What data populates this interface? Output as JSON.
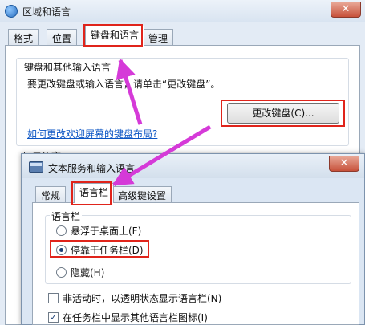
{
  "outer_window": {
    "title": "区域和语言",
    "close_glyph": "✕",
    "tabs": [
      "格式",
      "位置",
      "键盘和语言",
      "管理"
    ],
    "group_title": "键盘和其他输入语言",
    "group_desc": "要更改键盘或输入语言，请单击“更改键盘”。",
    "change_keyboard_button": "更改键盘(C)...",
    "keyboard_layout_link": "如何更改欢迎屏幕的键盘布局?",
    "display_language_label": "显示语言"
  },
  "inner_dialog": {
    "title": "文本服务和输入语言",
    "close_glyph": "✕",
    "tabs": [
      "常规",
      "语言栏",
      "高级键设置"
    ],
    "language_bar_group_title": "语言栏",
    "options": [
      {
        "label": "悬浮于桌面上(F)",
        "selected": false
      },
      {
        "label": "停靠于任务栏(D)",
        "selected": true
      },
      {
        "label": "隐藏(H)",
        "selected": false
      }
    ],
    "checkboxes": [
      {
        "label": "非活动时，以透明状态显示语言栏(N)",
        "checked": false
      },
      {
        "label": "在任务栏中显示其他语言栏图标(I)",
        "checked": true
      }
    ]
  },
  "colors": {
    "highlight_box": "#e0241b",
    "arrow": "#d53ad8",
    "link": "#0b55c4"
  }
}
